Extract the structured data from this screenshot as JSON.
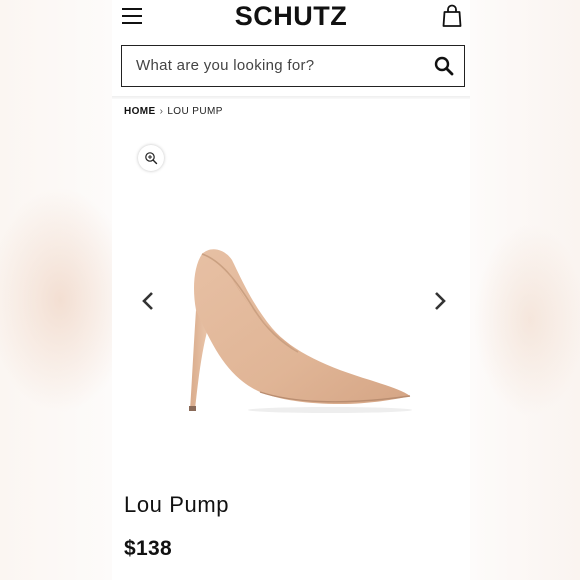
{
  "header": {
    "logo": "SCHUTZ",
    "menu_icon": "hamburger-menu-icon",
    "bag_icon": "shopping-bag-icon"
  },
  "search": {
    "placeholder": "What are you looking for?",
    "value": "",
    "icon": "search-icon"
  },
  "breadcrumb": {
    "home": "HOME",
    "separator": "›",
    "current": "LOU PUMP"
  },
  "gallery": {
    "zoom_icon": "zoom-in-icon",
    "prev_icon": "chevron-left-icon",
    "next_icon": "chevron-right-icon",
    "image_alt": "nude suede pointed-toe stiletto pump"
  },
  "product": {
    "name": "Lou Pump",
    "price": "$138"
  },
  "colors": {
    "text": "#111111",
    "suede": "#e2b89a",
    "suede_shadow": "#c99878"
  }
}
